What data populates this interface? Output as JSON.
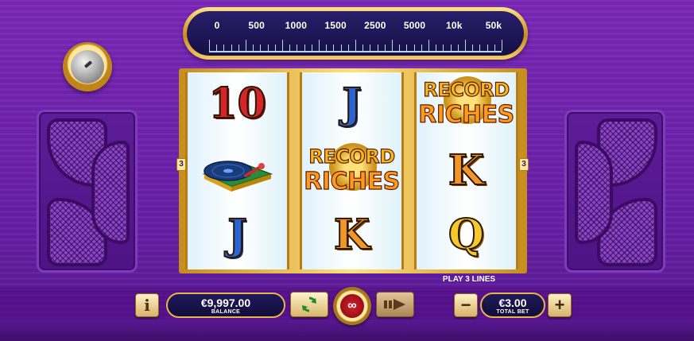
{
  "dial": {
    "labels": [
      "0",
      "500",
      "1000",
      "1500",
      "2500",
      "5000",
      "10k",
      "50k"
    ]
  },
  "reels": {
    "line_left": "3",
    "line_right": "3",
    "reel1": [
      "10",
      "turntable",
      "J"
    ],
    "reel2": [
      "J",
      "record-riches-logo",
      "K"
    ],
    "reel3": [
      "record-riches-logo",
      "K",
      "Q"
    ],
    "logo_line1": "RECORD",
    "logo_line2": "RICHES"
  },
  "play_lines": "PLAY 3 LINES",
  "controls": {
    "info_label": "i",
    "balance_value": "€9,997.00",
    "balance_label": "BALANCE",
    "autoplay_symbol": "∞",
    "minus_label": "−",
    "plus_label": "+",
    "total_bet_value": "€3.00",
    "total_bet_label": "TOTAL BET"
  },
  "colors": {
    "background": "#6a1fa8",
    "gold": "#f5c82c",
    "panel_dark": "#141044",
    "spin_red": "#d81f2a"
  },
  "icons": [
    "knob-icon",
    "turntable-icon",
    "reload-icon",
    "turbo-icon",
    "autoplay-icon"
  ]
}
